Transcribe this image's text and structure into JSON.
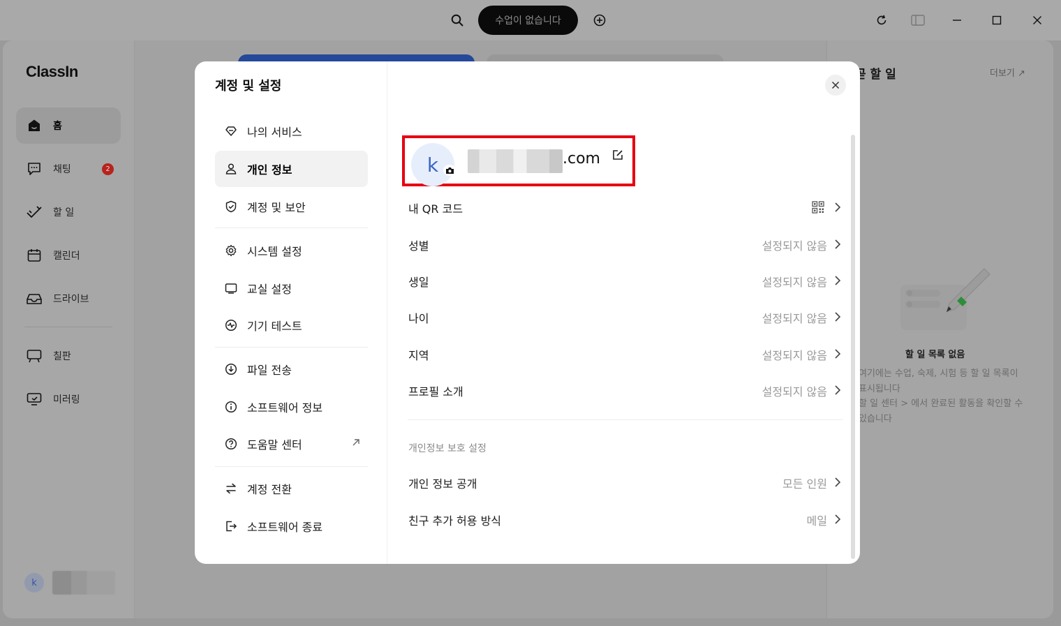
{
  "titlebar": {
    "class_status": "수업이 없습니다"
  },
  "app": {
    "logo": "ClassIn",
    "nav": [
      {
        "label": "홈",
        "icon": "home-icon"
      },
      {
        "label": "채팅",
        "icon": "chat-icon",
        "badge": "2"
      },
      {
        "label": "할 일",
        "icon": "todo-icon"
      },
      {
        "label": "캘린더",
        "icon": "calendar-icon"
      },
      {
        "label": "드라이브",
        "icon": "drive-icon"
      },
      {
        "label": "칠판",
        "icon": "blackboard-icon"
      },
      {
        "label": "미러링",
        "icon": "mirroring-icon"
      }
    ],
    "user_initial": "k"
  },
  "right_panel": {
    "title": "곧 할 일",
    "more": "더보기 ↗",
    "empty_title": "할 일 목록 없음",
    "empty_text_lines": [
      "여기에는 수업, 숙제, 시험 등 할 일 목록이",
      "표시됩니다",
      "할 일 센터 > 에서 완료된 활동을 확인할 수",
      "있습니다"
    ]
  },
  "modal": {
    "title": "계정 및 설정",
    "menu": [
      {
        "label": "나의 서비스",
        "icon": "diamond-icon"
      },
      {
        "label": "개인 정보",
        "icon": "person-icon",
        "active": true
      },
      {
        "label": "계정 및 보안",
        "icon": "shield-icon"
      },
      {
        "label": "시스템 설정",
        "icon": "gear-icon"
      },
      {
        "label": "교실 설정",
        "icon": "classroom-icon"
      },
      {
        "label": "기기 테스트",
        "icon": "device-test-icon"
      },
      {
        "label": "파일 전송",
        "icon": "download-icon"
      },
      {
        "label": "소프트웨어 정보",
        "icon": "info-icon"
      },
      {
        "label": "도움말 센터",
        "icon": "help-icon",
        "external": true
      },
      {
        "label": "계정 전환",
        "icon": "switch-icon"
      },
      {
        "label": "소프트웨어 종료",
        "icon": "logout-icon"
      }
    ],
    "profile": {
      "avatar_initial": "k",
      "email_suffix": ".com"
    },
    "rows": [
      {
        "label": "내 QR 코드",
        "value": "",
        "qr": true
      },
      {
        "label": "성별",
        "value": "설정되지 않음"
      },
      {
        "label": "생일",
        "value": "설정되지 않음"
      },
      {
        "label": "나이",
        "value": "설정되지 않음"
      },
      {
        "label": "지역",
        "value": "설정되지 않음"
      },
      {
        "label": "프로필 소개",
        "value": "설정되지 않음"
      }
    ],
    "privacy_section_title": "개인정보 보호 설정",
    "privacy_rows": [
      {
        "label": "개인 정보 공개",
        "value": "모든 인원"
      },
      {
        "label": "친구 추가 허용 방식",
        "value": "메일"
      }
    ]
  },
  "colors": {
    "highlight_box": "#e60012",
    "badge": "#d9261e",
    "avatar_text": "#3a66c6"
  }
}
